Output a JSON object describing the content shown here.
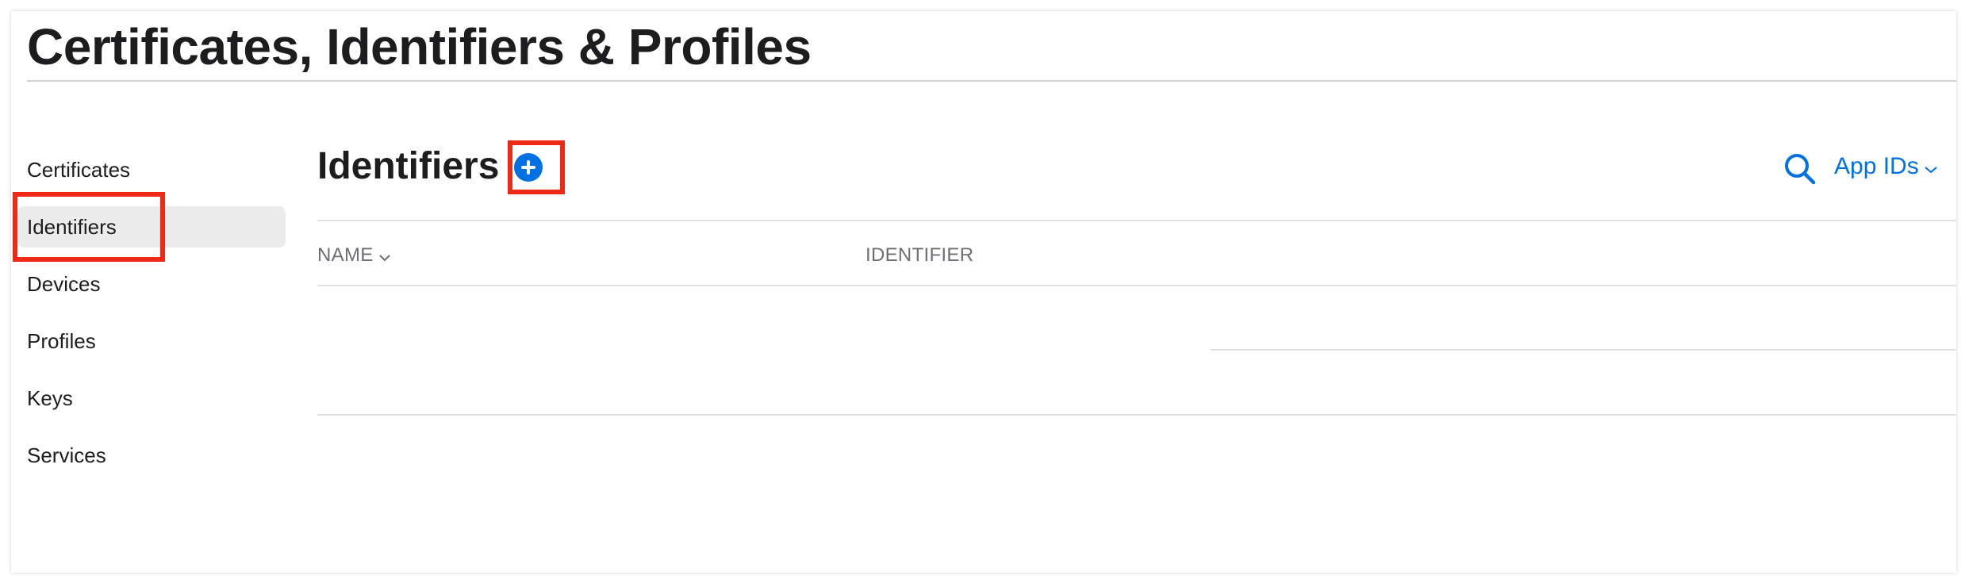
{
  "page": {
    "title": "Certificates, Identifiers & Profiles"
  },
  "sidebar": {
    "items": [
      {
        "label": "Certificates"
      },
      {
        "label": "Identifiers",
        "selected": true
      },
      {
        "label": "Devices"
      },
      {
        "label": "Profiles"
      },
      {
        "label": "Keys"
      },
      {
        "label": "Services"
      }
    ]
  },
  "main": {
    "section_title": "Identifiers",
    "add_icon": "plus-circle-icon",
    "search_icon": "search-icon",
    "filter": {
      "selected": "App IDs",
      "icon": "chevron-down-icon"
    },
    "table": {
      "columns": [
        {
          "label": "NAME",
          "sortable": true
        },
        {
          "label": "IDENTIFIER"
        }
      ],
      "rows": []
    }
  },
  "colors": {
    "accent": "#0071e3",
    "highlight": "#ee2a14",
    "selected_bg": "#ececec",
    "text": "#1d1d1f",
    "muted": "#6e6e73"
  }
}
